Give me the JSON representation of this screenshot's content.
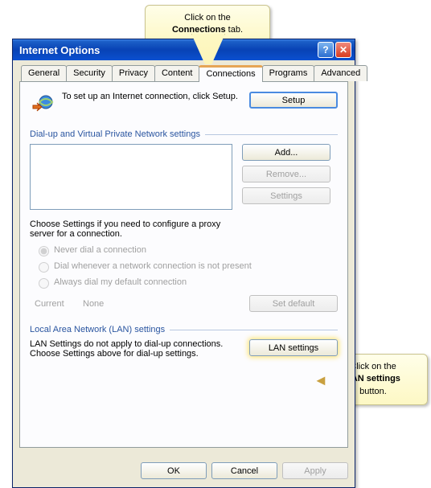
{
  "callouts": {
    "top_line1": "Click on the",
    "top_line2_strong": "Connections",
    "top_line2_rest": " tab.",
    "right_line1": "Click on the",
    "right_line2_strong": "LAN settings",
    "right_line3": "button."
  },
  "window": {
    "title": "Internet Options"
  },
  "tabs": {
    "general": "General",
    "security": "Security",
    "privacy": "Privacy",
    "content": "Content",
    "connections": "Connections",
    "programs": "Programs",
    "advanced": "Advanced"
  },
  "setup": {
    "text": "To set up an Internet connection, click Setup.",
    "button": "Setup"
  },
  "dialup": {
    "group_label": "Dial-up and Virtual Private Network settings",
    "add_button": "Add...",
    "remove_button": "Remove...",
    "settings_button": "Settings",
    "hint": "Choose Settings if you need to configure a proxy server for a connection.",
    "radio_never": "Never dial a connection",
    "radio_whenever": "Dial whenever a network connection is not present",
    "radio_always": "Always dial my default connection",
    "current_label": "Current",
    "current_value": "None",
    "set_default": "Set default"
  },
  "lan": {
    "group_label": "Local Area Network (LAN) settings",
    "text": "LAN Settings do not apply to dial-up connections. Choose Settings above for dial-up settings.",
    "button": "LAN settings"
  },
  "footer": {
    "ok": "OK",
    "cancel": "Cancel",
    "apply": "Apply"
  }
}
